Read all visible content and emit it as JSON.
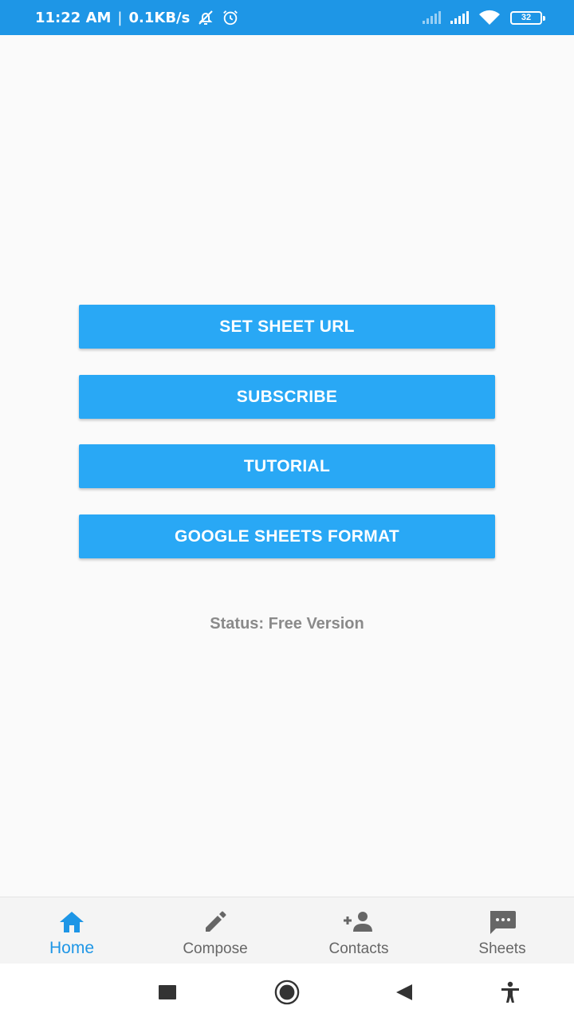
{
  "status_bar": {
    "time": "11:22 AM",
    "separator": "|",
    "speed": "0.1KB/s",
    "battery": "32",
    "icons": [
      "notifications-off-icon",
      "alarm-icon",
      "signal-icon",
      "signal-icon",
      "wifi-icon",
      "battery-icon"
    ]
  },
  "actions": {
    "set_sheet_url": "SET SHEET URL",
    "subscribe": "SUBSCRIBE",
    "tutorial": "TUTORIAL",
    "google_sheets_format": "GOOGLE SHEETS FORMAT"
  },
  "status_text": "Status: Free Version",
  "bottom_nav": {
    "items": [
      {
        "label": "Home",
        "icon": "home-icon",
        "active": true
      },
      {
        "label": "Compose",
        "icon": "pencil-icon",
        "active": false
      },
      {
        "label": "Contacts",
        "icon": "add-person-icon",
        "active": false
      },
      {
        "label": "Sheets",
        "icon": "chat-bubble-icon",
        "active": false
      }
    ]
  },
  "system_nav": {
    "icons": [
      "recents-icon",
      "home-circle-icon",
      "back-icon",
      "accessibility-icon"
    ]
  },
  "colors": {
    "status_bar": "#1e96e6",
    "button": "#29a8f5",
    "active_nav": "#1e96e6",
    "inactive_nav": "#666666",
    "status_text": "#8a8a8a",
    "background": "#fafafa"
  }
}
